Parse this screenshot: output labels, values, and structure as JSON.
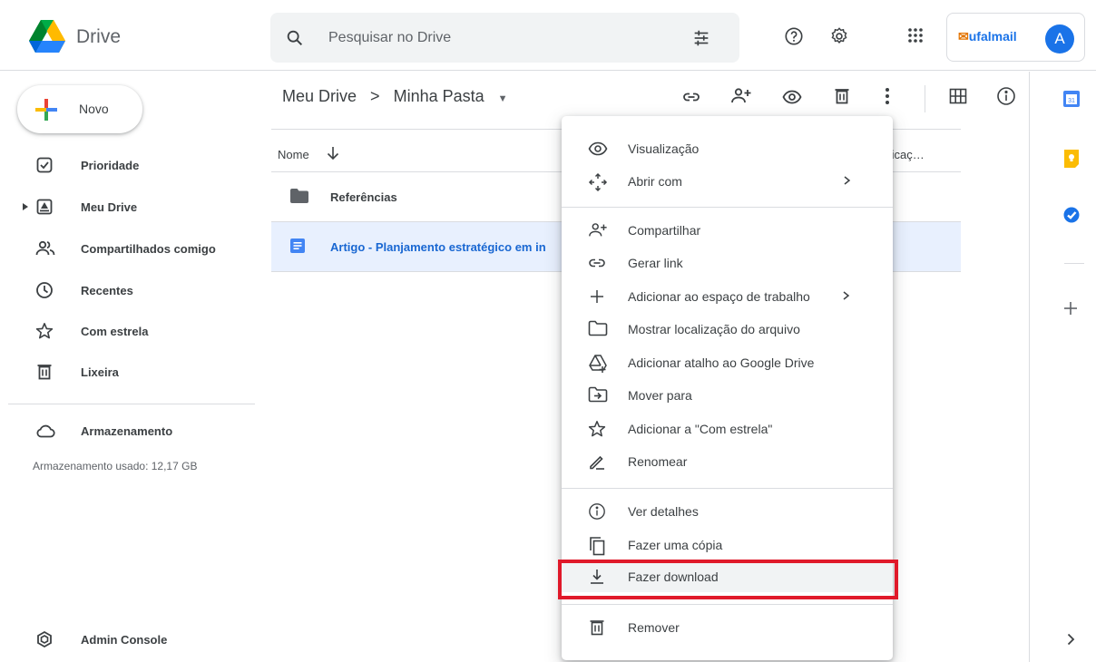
{
  "header": {
    "brand": "Drive",
    "search_placeholder": "Pesquisar no Drive",
    "org_name": "ufalmail",
    "avatar_initial": "A"
  },
  "sidebar": {
    "new_label": "Novo",
    "items": [
      {
        "label": "Prioridade",
        "icon": "priority-icon"
      },
      {
        "label": "Meu Drive",
        "icon": "my-drive-icon"
      },
      {
        "label": "Compartilhados comigo",
        "icon": "shared-icon"
      },
      {
        "label": "Recentes",
        "icon": "clock-icon"
      },
      {
        "label": "Com estrela",
        "icon": "star-icon"
      },
      {
        "label": "Lixeira",
        "icon": "trash-icon"
      }
    ],
    "storage_label": "Armazenamento",
    "storage_used": "Armazenamento usado: 12,17 GB",
    "admin_label": "Admin Console"
  },
  "main": {
    "breadcrumb_root": "Meu Drive",
    "breadcrumb_sep": ">",
    "breadcrumb_current": "Minha Pasta",
    "col_name": "Nome",
    "col_modified": "ficaç…",
    "rows": [
      {
        "name": "Referências",
        "type": "folder"
      },
      {
        "name": "Artigo - Planjamento estratégico em in",
        "type": "doc"
      }
    ]
  },
  "context_menu": {
    "items": [
      {
        "label": "Visualização",
        "icon": "eye-icon"
      },
      {
        "label": "Abrir com",
        "icon": "move-arrows-icon"
      },
      {
        "label": "Compartilhar",
        "icon": "add-person-icon"
      },
      {
        "label": "Gerar link",
        "icon": "link-icon"
      },
      {
        "label": "Adicionar ao espaço de trabalho",
        "icon": "plus-icon"
      },
      {
        "label": "Mostrar localização do arquivo",
        "icon": "folder-outline-icon"
      },
      {
        "label": "Adicionar atalho ao Google Drive",
        "icon": "drive-shortcut-icon"
      },
      {
        "label": "Mover para",
        "icon": "move-to-icon"
      },
      {
        "label": "Adicionar a \"Com estrela\"",
        "icon": "star-icon"
      },
      {
        "label": "Renomear",
        "icon": "pencil-icon"
      },
      {
        "label": "Ver detalhes",
        "icon": "info-icon"
      },
      {
        "label": "Fazer uma cópia",
        "icon": "copy-icon"
      },
      {
        "label": "Fazer download",
        "icon": "download-icon"
      },
      {
        "label": "Remover",
        "icon": "trash-icon"
      }
    ],
    "highlight_color": "#e0192a"
  },
  "colors": {
    "accent": "#1a73e8",
    "selected_row": "#e8f0fe"
  }
}
